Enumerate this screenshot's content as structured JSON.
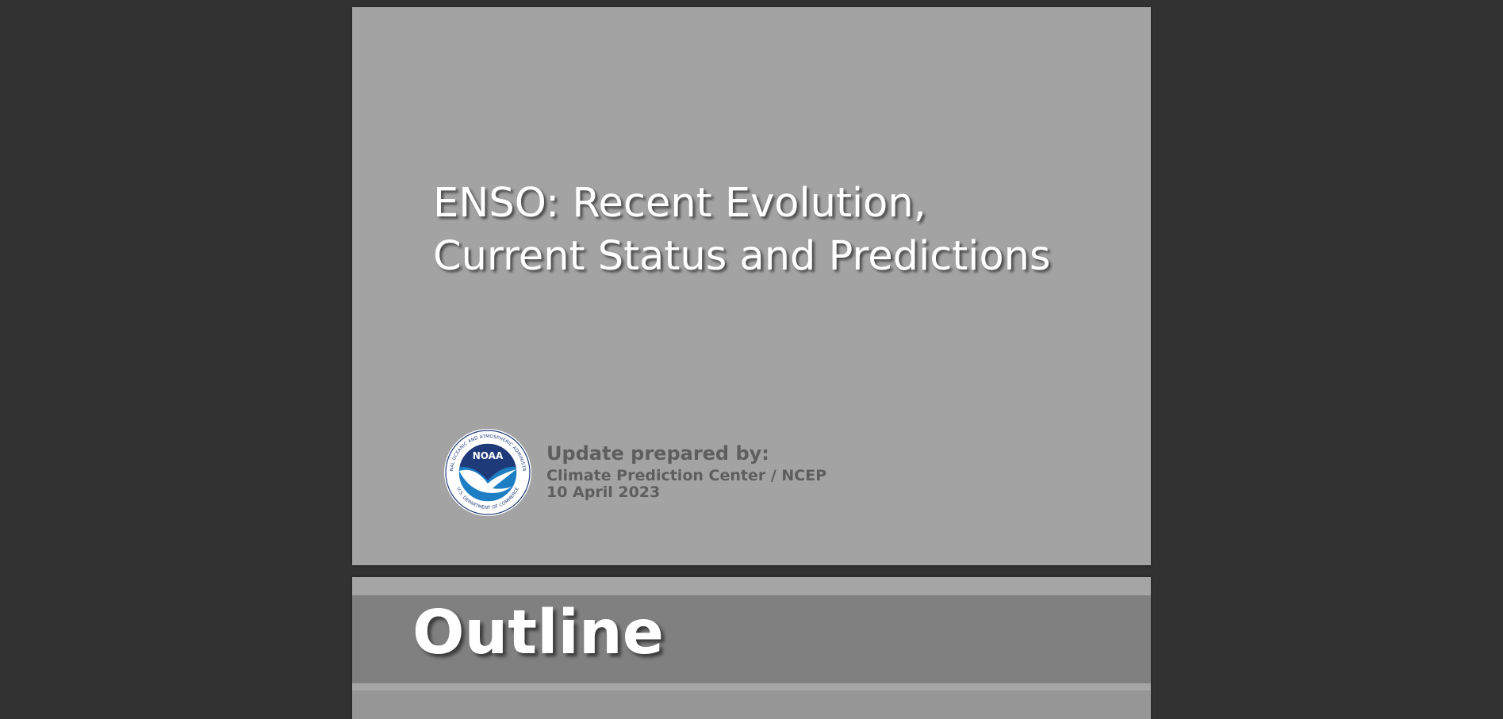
{
  "slides": [
    {
      "title_lines": [
        "ENSO: Recent Evolution,",
        "Current Status and Predictions"
      ],
      "logo": {
        "icon": "noaa-logo",
        "seal_text_top": "NATIONAL OCEANIC AND ATMOSPHERIC ADMINISTRATION",
        "seal_text_bottom": "U.S. DEPARTMENT OF COMMERCE",
        "emblem_text": "NOAA"
      },
      "credit": {
        "heading": "Update prepared by:",
        "org": "Climate Prediction Center / NCEP",
        "date": "10 April 2023"
      }
    },
    {
      "title": "Outline"
    }
  ],
  "colors": {
    "viewer_background": "#323232",
    "slide_background": "#a3a3a3",
    "outline_band": "#808080",
    "credit_text": "#5e5e5e",
    "noaa_navy": "#1f3a78",
    "noaa_blue": "#1d7ec4"
  }
}
